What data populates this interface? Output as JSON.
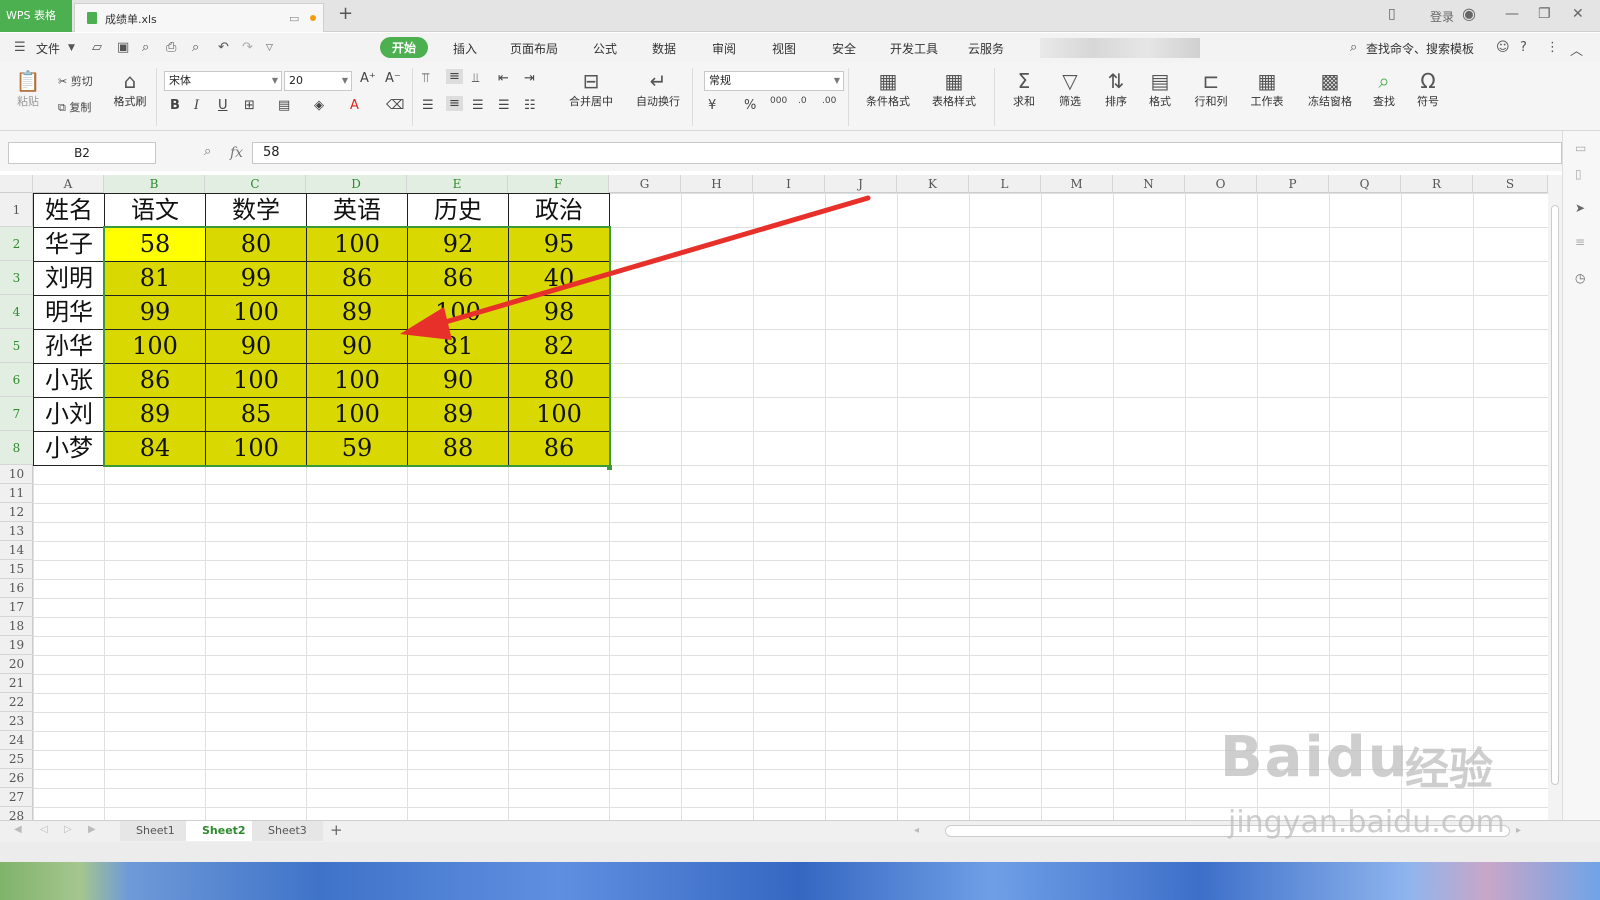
{
  "titlebar": {
    "app_tab": "WPS 表格",
    "file_name": "成绩单.xls",
    "new_tab": "+",
    "login": "登录"
  },
  "menubar": {
    "file": "文件",
    "tabs": [
      "开始",
      "插入",
      "页面布局",
      "公式",
      "数据",
      "审阅",
      "视图",
      "安全",
      "开发工具",
      "云服务"
    ],
    "search_cmd": "查找命令、搜索模板"
  },
  "ribbon": {
    "paste": "粘贴",
    "cut": "剪切",
    "copy": "复制",
    "format_painter": "格式刷",
    "font_name": "宋体",
    "font_size": "20",
    "merge_center": "合并居中",
    "wrap_text": "自动换行",
    "number_format": "常规",
    "cond_format": "条件格式",
    "table_style": "表格样式",
    "sum": "求和",
    "filter": "筛选",
    "sort": "排序",
    "format": "格式",
    "row_col": "行和列",
    "worksheet": "工作表",
    "freeze": "冻结窗格",
    "find": "查找",
    "symbol": "符号"
  },
  "formula_bar": {
    "cell_ref": "B2",
    "fx": "fx",
    "value": "58"
  },
  "grid": {
    "columns": [
      "A",
      "B",
      "C",
      "D",
      "E",
      "F",
      "G",
      "H",
      "I",
      "J",
      "K",
      "L",
      "M",
      "N",
      "O",
      "P",
      "Q",
      "R",
      "S"
    ],
    "rows": [
      "1",
      "2",
      "3",
      "4",
      "5",
      "6",
      "7",
      "8",
      "10",
      "11",
      "12",
      "13",
      "14",
      "15",
      "16",
      "17",
      "18",
      "19",
      "20",
      "21",
      "22",
      "23",
      "24",
      "25",
      "26",
      "27",
      "28"
    ],
    "headers": [
      "姓名",
      "语文",
      "数学",
      "英语",
      "历史",
      "政治"
    ],
    "data": [
      [
        "华子",
        "58",
        "80",
        "100",
        "92",
        "95"
      ],
      [
        "刘明",
        "81",
        "99",
        "86",
        "86",
        "40"
      ],
      [
        "明华",
        "99",
        "100",
        "89",
        "100",
        "98"
      ],
      [
        "孙华",
        "100",
        "90",
        "90",
        "81",
        "82"
      ],
      [
        "小张",
        "86",
        "100",
        "100",
        "90",
        "80"
      ],
      [
        "小刘",
        "89",
        "85",
        "100",
        "89",
        "100"
      ],
      [
        "小梦",
        "84",
        "100",
        "59",
        "88",
        "86"
      ]
    ],
    "highlight_color": "#d9d800",
    "active_cell_color": "#ffff00"
  },
  "sheets": [
    "Sheet1",
    "Sheet2",
    "Sheet3"
  ],
  "active_sheet": "Sheet2",
  "watermark": {
    "brand": "Baidu",
    "cn": "经验",
    "url": "jingyan.baidu.com"
  },
  "annotation": {
    "color": "#e8302a"
  }
}
